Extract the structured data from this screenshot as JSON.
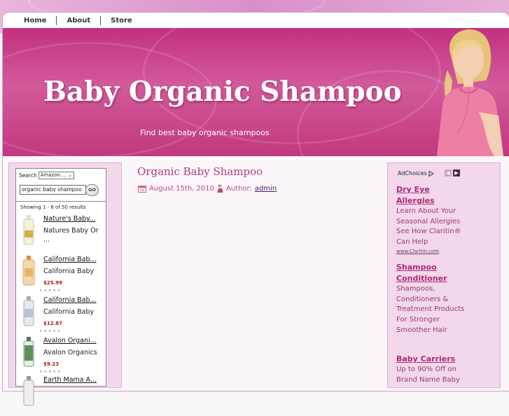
{
  "nav": {
    "items": [
      "Home",
      "About",
      "Store"
    ]
  },
  "header": {
    "title": "Baby Organic Shampoo",
    "tagline": "Find best baby organic shampoos"
  },
  "widget": {
    "search_label": "Search",
    "search_select": "Amazon....",
    "search_value": "organic baby shampoo",
    "go_label": "GO",
    "results_count": "Showing 1 - 6 of 50 results",
    "products": [
      {
        "title": "Nature's Baby...",
        "sub": "Natures Baby Or",
        "sub2": "...",
        "price": ""
      },
      {
        "title": "California Bab...",
        "sub": "California Baby",
        "sub2": "",
        "price": "$25.99"
      },
      {
        "title": "California Bab...",
        "sub": "California Baby",
        "sub2": "",
        "price": "$12.87"
      },
      {
        "title": "Avalon Organi...",
        "sub": "Avalon Organics",
        "sub2": "",
        "price": "$9.23"
      },
      {
        "title": "Earth Mama A...",
        "sub": "",
        "sub2": "",
        "price": ""
      }
    ]
  },
  "post": {
    "title": "Organic Baby Shampoo",
    "date": "August 15th, 2010",
    "author_label": "Author:",
    "author": "admin"
  },
  "ads": {
    "adchoices": "AdChoices",
    "items": [
      {
        "title": "Dry Eye Allergies",
        "body": "Learn About Your Seasonal Allergies See How Claritin® Can Help",
        "url": "www.Claritin.com"
      },
      {
        "title": "Shampoo Conditioner",
        "body": "Shampoos, Conditioners & Treatment Products For Stronger Smoother Hair",
        "url": ""
      },
      {
        "title": "Baby Carriers",
        "body": "Up to 90% Off on Brand Name Baby",
        "url": ""
      }
    ]
  },
  "colors": {
    "accent": "#c3307f",
    "ad_title": "#b0287a",
    "price": "#b01616"
  }
}
